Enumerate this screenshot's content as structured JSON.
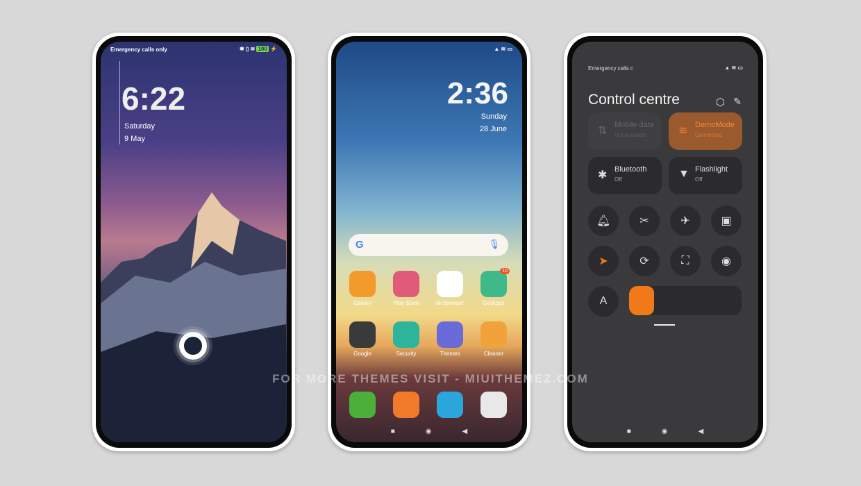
{
  "lockscreen": {
    "status": "Emergency calls only",
    "battery": "100",
    "time": "6:22",
    "day": "Saturday",
    "date": "9 May"
  },
  "homescreen": {
    "time": "2:36",
    "day": "Sunday",
    "date": "28 June",
    "search_placeholder": "",
    "apps": [
      {
        "label": "Gallery",
        "color": "#f29a2a"
      },
      {
        "label": "Play Store",
        "color": "#e05a7a"
      },
      {
        "label": "Mi Browser",
        "color": "#ffffff"
      },
      {
        "label": "GetApps",
        "color": "#3fb98a",
        "badge": "10"
      },
      {
        "label": "Google",
        "color": "#3a3a3a"
      },
      {
        "label": "Security",
        "color": "#2cb59a"
      },
      {
        "label": "Themes",
        "color": "#6a6ad8"
      },
      {
        "label": "Cleaner",
        "color": "#f2a23a"
      }
    ],
    "dock": [
      {
        "name": "phone",
        "color": "#4caf3a"
      },
      {
        "name": "messages",
        "color": "#f07a2a"
      },
      {
        "name": "camera-app",
        "color": "#2aa6dc"
      },
      {
        "name": "camera",
        "color": "#e8e8e8"
      }
    ]
  },
  "control": {
    "status": "Emergency calls c",
    "title": "Control centre",
    "tiles": [
      {
        "label": "Mobile data",
        "sub": "Not available"
      },
      {
        "label": "DemoMode",
        "sub": "Connected"
      },
      {
        "label": "Bluetooth",
        "sub": "Off"
      },
      {
        "label": "Flashlight",
        "sub": "Off"
      }
    ],
    "accent": "#f07a1a",
    "brightness": 0.2,
    "font_icon": "A"
  },
  "watermark": "FOR MORE THEMES VISIT - MIUITHEMEZ.COM"
}
